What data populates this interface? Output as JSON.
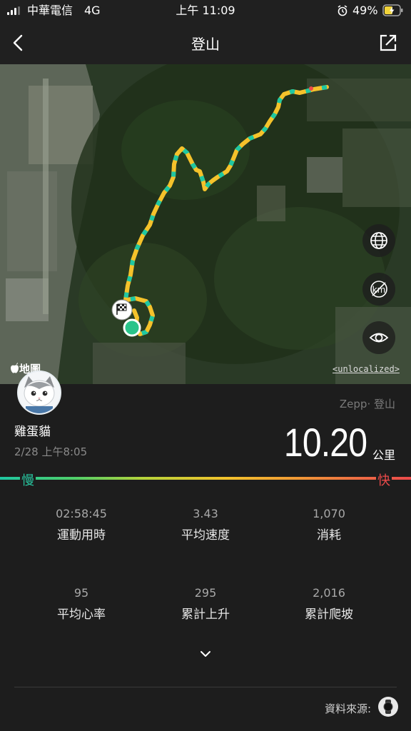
{
  "status_bar": {
    "carrier": "中華電信",
    "network": "4G",
    "time": "上午 11:09",
    "battery": "49%"
  },
  "nav": {
    "title": "登山"
  },
  "map": {
    "apple_maps_label": "地圖",
    "unlocalized_label": "<unlocalized>",
    "buttons": [
      "globe-icon",
      "km-icon",
      "eye-icon"
    ]
  },
  "user": {
    "name": "雞蛋貓",
    "date": "2/28 上午8:05"
  },
  "workout": {
    "source": "Zepp‧ 登山",
    "distance": "10.20",
    "distance_unit": "公里"
  },
  "speed_scale": {
    "slow": "慢",
    "fast": "快",
    "slow_color": "#28c6a0",
    "fast_color": "#ec4a4a"
  },
  "stats": [
    {
      "value": "02:58:45",
      "label": "運動用時"
    },
    {
      "value": "3.43",
      "label": "平均速度"
    },
    {
      "value": "1,070",
      "label": "消耗"
    },
    {
      "value": "95",
      "label": "平均心率"
    },
    {
      "value": "295",
      "label": "累計上升"
    },
    {
      "value": "2,016",
      "label": "累計爬坡"
    }
  ],
  "footer": {
    "source_label": "資料來源:"
  },
  "colors": {
    "route_fast": "#1fc7a2",
    "route_slow": "#f5c22b",
    "background": "#1d1d1d"
  }
}
